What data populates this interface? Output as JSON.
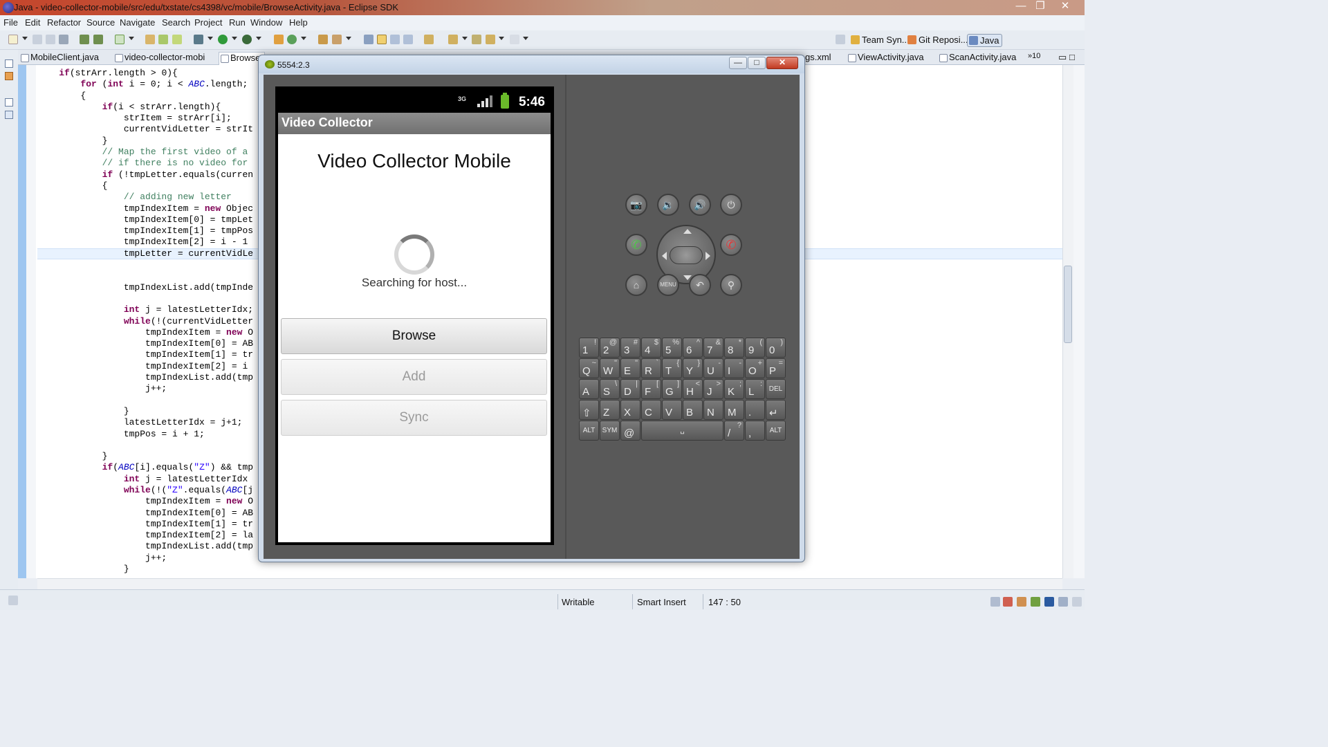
{
  "window": {
    "title": "Java - video-collector-mobile/src/edu/txstate/cs4398/vc/mobile/BrowseActivity.java - Eclipse SDK",
    "controls": [
      "—",
      "❐",
      "✕"
    ]
  },
  "menu": [
    "File",
    "Edit",
    "Refactor",
    "Source",
    "Navigate",
    "Search",
    "Project",
    "Run",
    "Window",
    "Help"
  ],
  "perspectives": {
    "team_sync": "Team Syn...",
    "git_repo": "Git Reposi...",
    "java": "Java"
  },
  "editor_tabs": {
    "items": [
      "MobileClient.java",
      "video-collector-mobi",
      "Browse",
      "gs.xml",
      "ViewActivity.java",
      "ScanActivity.java"
    ],
    "overflow": "»10"
  },
  "code_lines": [
    "    if(strArr.length > 0){",
    "        for (int i = 0; i < ABC.length;",
    "        {",
    "            if(i < strArr.length){",
    "                strItem = strArr[i];",
    "                currentVidLetter = strIt",
    "            }",
    "            // Map the first video of a",
    "            // if there is no video for",
    "            if (!tmpLetter.equals(curren",
    "            {",
    "                // adding new letter",
    "                tmpIndexItem = new Objec",
    "                tmpIndexItem[0] = tmpLet",
    "                tmpIndexItem[1] = tmpPos",
    "                tmpIndexItem[2] = i - 1",
    "                tmpLetter = currentVidLe",
    "",
    "",
    "                tmpIndexList.add(tmpInde",
    "",
    "                int j = latestLetterIdx;",
    "                while(!(currentVidLetter",
    "                    tmpIndexItem = new O",
    "                    tmpIndexItem[0] = AB",
    "                    tmpIndexItem[1] = tr",
    "                    tmpIndexItem[2] = i",
    "                    tmpIndexList.add(tmp",
    "                    j++;",
    "",
    "                }",
    "                latestLetterIdx = j+1;",
    "                tmpPos = i + 1;",
    "",
    "            }",
    "            if(ABC[i].equals(\"Z\") && tmp",
    "                int j = latestLetterIdx",
    "                while(!(\"Z\".equals(ABC[j",
    "                    tmpIndexItem = new O",
    "                    tmpIndexItem[0] = AB",
    "                    tmpIndexItem[1] = tr",
    "                    tmpIndexItem[2] = la",
    "                    tmpIndexList.add(tmp",
    "                    j++;",
    "                }"
  ],
  "status": {
    "writable": "Writable",
    "insert_mode": "Smart Insert",
    "position": "147 : 50"
  },
  "emulator": {
    "title": "5554:2.3",
    "status_bar": {
      "network": "3G",
      "time": "5:46"
    },
    "app_title": "Video Collector",
    "heading": "Video Collector Mobile",
    "progress_text": "Searching for host...",
    "buttons": [
      {
        "label": "Browse",
        "enabled": true
      },
      {
        "label": "Add",
        "enabled": false
      },
      {
        "label": "Sync",
        "enabled": false
      }
    ],
    "hw_controls": {
      "camera": "📷",
      "vol_down": "🔉",
      "vol_up": "🔊",
      "power": "⏻",
      "call": "✆",
      "end_call": "✆",
      "home": "⌂",
      "menu": "MENU",
      "back": "↶",
      "search": "⚲"
    },
    "keyboard": {
      "row1": [
        [
          "1",
          "!"
        ],
        [
          "2",
          "@"
        ],
        [
          "3",
          "#"
        ],
        [
          "4",
          "$"
        ],
        [
          "5",
          "%"
        ],
        [
          "6",
          "^"
        ],
        [
          "7",
          "&"
        ],
        [
          "8",
          "*"
        ],
        [
          "9",
          "("
        ],
        [
          "0",
          ")"
        ]
      ],
      "row2": [
        [
          "Q",
          "~"
        ],
        [
          "W",
          "\""
        ],
        [
          "E",
          "\""
        ],
        [
          "R",
          "`"
        ],
        [
          "T",
          "{"
        ],
        [
          "Y",
          "}"
        ],
        [
          "U",
          "-"
        ],
        [
          "I",
          "-"
        ],
        [
          "O",
          "+"
        ],
        [
          "P",
          "="
        ]
      ],
      "row3": [
        [
          "A",
          ""
        ],
        [
          "S",
          "\\"
        ],
        [
          "D",
          "|"
        ],
        [
          "F",
          "["
        ],
        [
          "G",
          "]"
        ],
        [
          "H",
          "<"
        ],
        [
          "J",
          ">"
        ],
        [
          "K",
          ";"
        ],
        [
          "L",
          ":"
        ],
        [
          "DEL",
          ""
        ]
      ],
      "row4": [
        [
          "⇧",
          ""
        ],
        [
          "Z",
          ""
        ],
        [
          "X",
          ""
        ],
        [
          "C",
          ""
        ],
        [
          "V",
          ""
        ],
        [
          "B",
          ""
        ],
        [
          "N",
          ""
        ],
        [
          "M",
          ""
        ],
        [
          ".",
          ""
        ],
        [
          "↵",
          ""
        ]
      ],
      "row5": {
        "alt_left": "ALT",
        "sym": "SYM",
        "at": "@",
        "space": "␣",
        "slash": "/",
        "question": "?",
        "comma": ",",
        "alt_right": "ALT"
      }
    }
  },
  "colors": {
    "keyword": "#7f0055",
    "comment": "#3f7f5f",
    "string": "#2a00ff",
    "field": "#0000c0"
  }
}
